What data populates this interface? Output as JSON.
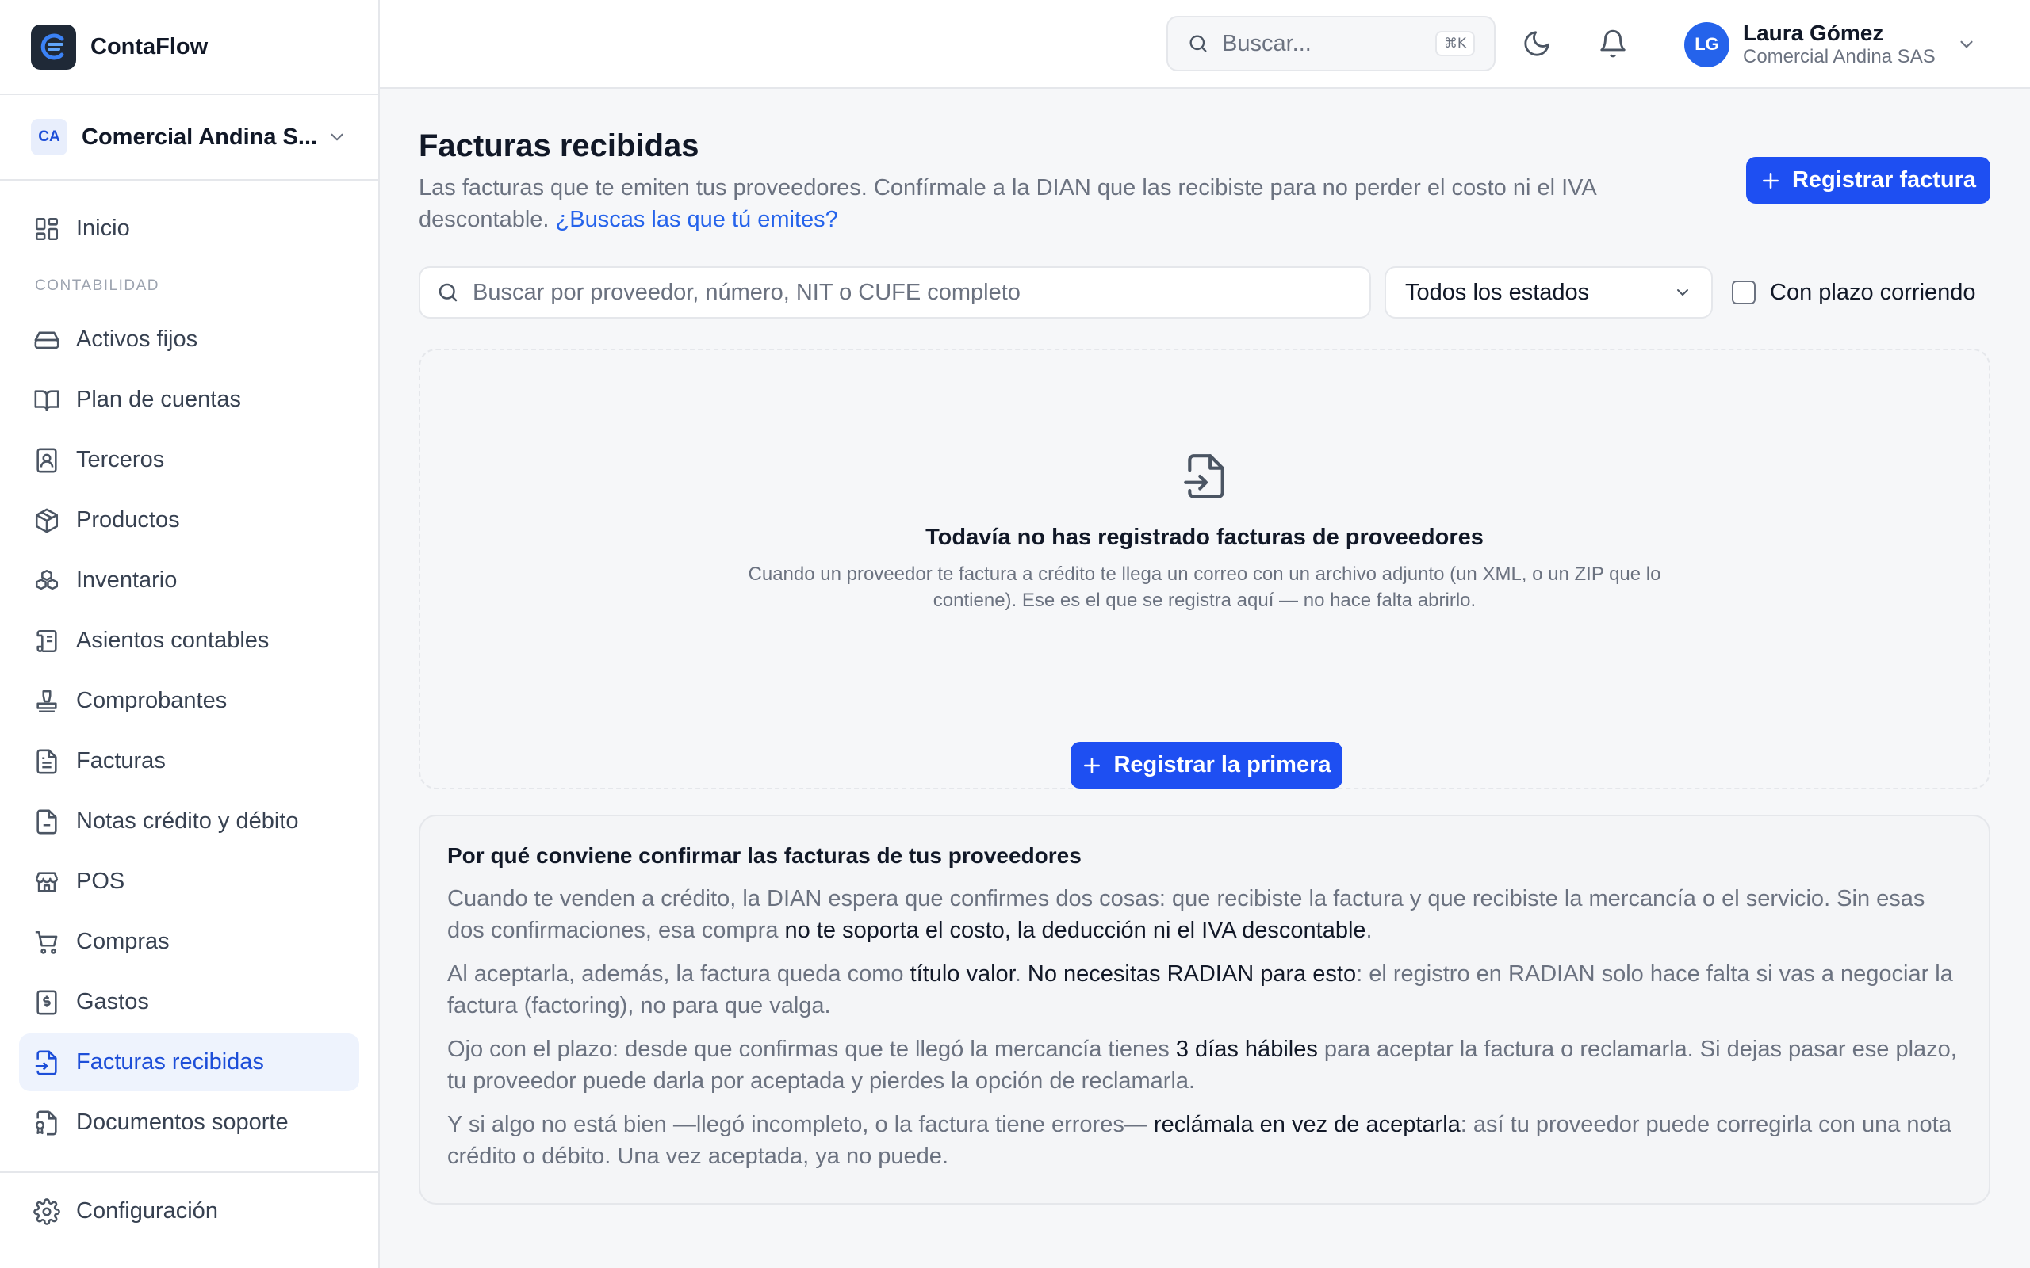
{
  "app": {
    "name": "ContaFlow"
  },
  "company": {
    "badge": "CA",
    "name": "Comercial Andina S..."
  },
  "sidebar": {
    "items_top": [
      {
        "label": "Inicio",
        "icon": "dashboard-icon"
      }
    ],
    "section_label": "CONTABILIDAD",
    "items": [
      {
        "label": "Activos fijos",
        "icon": "hard-drive-icon"
      },
      {
        "label": "Plan de cuentas",
        "icon": "book-open-icon"
      },
      {
        "label": "Terceros",
        "icon": "contact-icon"
      },
      {
        "label": "Productos",
        "icon": "package-icon"
      },
      {
        "label": "Inventario",
        "icon": "boxes-icon"
      },
      {
        "label": "Asientos contables",
        "icon": "scroll-icon"
      },
      {
        "label": "Comprobantes",
        "icon": "stamp-icon"
      },
      {
        "label": "Facturas",
        "icon": "file-text-icon"
      },
      {
        "label": "Notas crédito y débito",
        "icon": "file-icon"
      },
      {
        "label": "POS",
        "icon": "store-icon"
      },
      {
        "label": "Compras",
        "icon": "cart-icon"
      },
      {
        "label": "Gastos",
        "icon": "receipt-icon"
      },
      {
        "label": "Facturas recibidas",
        "icon": "file-input-icon",
        "active": true
      },
      {
        "label": "Documentos soporte",
        "icon": "file-badge-icon"
      }
    ],
    "footer": {
      "label": "Configuración",
      "icon": "gear-icon"
    }
  },
  "topbar": {
    "search_placeholder": "Buscar...",
    "shortcut": "⌘K",
    "user": {
      "initials": "LG",
      "name": "Laura Gómez",
      "company": "Comercial Andina SAS"
    }
  },
  "page": {
    "title": "Facturas recibidas",
    "subtitle": "Las facturas que te emiten tus proveedores. Confírmale a la DIAN que las recibiste para no perder el costo ni el IVA descontable.",
    "subtitle_link": "¿Buscas las que tú emites?",
    "register_button": "Registrar factura"
  },
  "filters": {
    "search_placeholder": "Buscar por proveedor, número, NIT o CUFE completo",
    "status_select": "Todos los estados",
    "checkbox_label": "Con plazo corriendo",
    "checkbox_checked": false
  },
  "empty_state": {
    "title": "Todavía no has registrado facturas de proveedores",
    "text": "Cuando un proveedor te factura a crédito te llega un correo con un archivo adjunto (un XML, o un ZIP que lo contiene). Ese es el que se registra aquí — no hace falta abrirlo.",
    "button": "Registrar la primera"
  },
  "info": {
    "title": "Por qué conviene confirmar las facturas de tus proveedores",
    "p1": {
      "a": "Cuando te venden a crédito, la DIAN espera que confirmes dos cosas: que recibiste la factura y que recibiste la mercancía o el servicio. Sin esas dos confirmaciones, esa compra ",
      "b": "no te soporta el costo, la deducción ni el IVA descontable",
      "c": "."
    },
    "p2": {
      "a": "Al aceptarla, además, la factura queda como ",
      "b": "título valor",
      "c": ". ",
      "d": "No necesitas RADIAN para esto",
      "e": ": el registro en RADIAN solo hace falta si vas a negociar la factura (factoring), no para que valga."
    },
    "p3": {
      "a": "Ojo con el plazo: desde que confirmas que te llegó la mercancía tienes ",
      "b": "3 días hábiles",
      "c": " para aceptar la factura o reclamarla. Si dejas pasar ese plazo, tu proveedor puede darla por aceptada y pierdes la opción de reclamarla."
    },
    "p4": {
      "a": "Y si algo no está bien —llegó incompleto, o la factura tiene errores— ",
      "b": "reclámala en vez de aceptarla",
      "c": ": así tu proveedor puede corregirla con una nota crédito o débito. Una vez aceptada, ya no puede."
    }
  },
  "colors": {
    "accent": "#1e4ff2",
    "active_bg": "#eef3fd",
    "link": "#2563eb"
  }
}
